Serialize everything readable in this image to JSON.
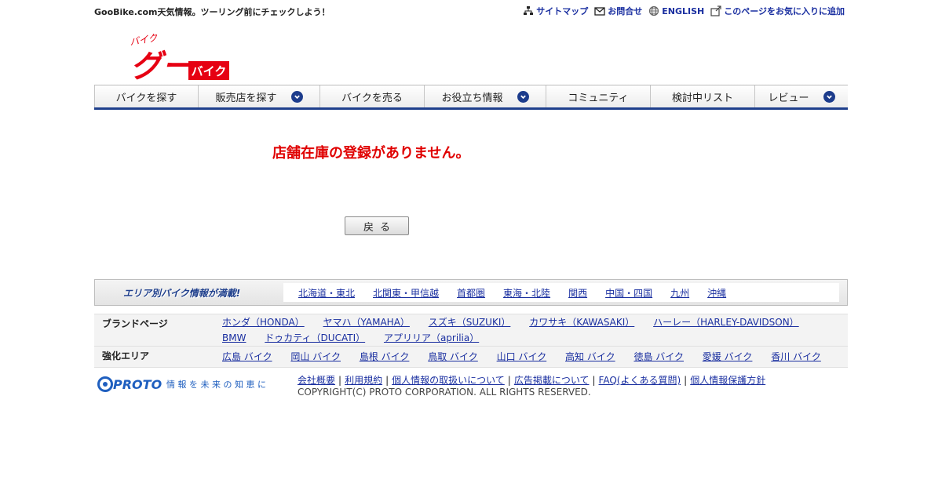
{
  "header": {
    "tagline": "GooBike.com天気情報。ツーリング前にチェックしよう！",
    "links": [
      {
        "label": "サイトマップ",
        "icon": "sitemap-icon"
      },
      {
        "label": "お問合せ",
        "icon": "mail-icon"
      },
      {
        "label": "ENGLISH",
        "icon": "globe-icon"
      },
      {
        "label": "このページをお気に入りに追加",
        "icon": "bookmark-add-icon"
      }
    ],
    "logo": {
      "small_text": "バイク",
      "main_text": "グー",
      "badge_text": "バイク",
      "brand_color": "#e60012"
    }
  },
  "nav": [
    {
      "label": "バイクを探す",
      "dropdown": false
    },
    {
      "label": "販売店を探す",
      "dropdown": true
    },
    {
      "label": "バイクを売る",
      "dropdown": false
    },
    {
      "label": "お役立ち情報",
      "dropdown": true
    },
    {
      "label": "コミュニティ",
      "dropdown": false
    },
    {
      "label": "検討中リスト",
      "dropdown": false
    },
    {
      "label": "レビュー",
      "dropdown": true
    }
  ],
  "main": {
    "message": "店舗在庫の登録がありません。",
    "back_button": "戻る"
  },
  "area_bar": {
    "title": "エリア別バイク情報が満載!",
    "links": [
      "北海道・東北",
      "北関東・甲信越",
      "首都圏",
      "東海・北陸",
      "関西",
      "中国・四国",
      "九州",
      "沖縄"
    ]
  },
  "brand_pages": {
    "label": "ブランドページ",
    "links": [
      "ホンダ（HONDA）",
      "ヤマハ（YAMAHA）",
      "スズキ（SUZUKI）",
      "カワサキ（KAWASAKI）",
      "ハーレー（HARLEY-DAVIDSON）",
      "BMW",
      "ドゥカティ（DUCATI）",
      "アプリリア（aprilia）"
    ]
  },
  "focus_areas": {
    "label": "強化エリア",
    "links": [
      "広島 バイク",
      "岡山 バイク",
      "島根 バイク",
      "鳥取 バイク",
      "山口 バイク",
      "高知 バイク",
      "徳島 バイク",
      "愛媛 バイク",
      "香川 バイク"
    ]
  },
  "footer": {
    "logo_text": "PROTO",
    "logo_tagline": "情 報 を 未 来 の 知 恵 に",
    "links": [
      "会社概要",
      "利用規約",
      "個人情報の取扱いについて",
      "広告掲載について",
      "FAQ(よくある質問)",
      "個人情報保護方針"
    ],
    "copyright": "COPYRIGHT(C) PROTO CORPORATION. ALL RIGHTS RESERVED."
  },
  "colors": {
    "nav_accent": "#1f3f8c",
    "link": "#1a2fa0",
    "error": "#e00000",
    "brand_red": "#e60012"
  }
}
